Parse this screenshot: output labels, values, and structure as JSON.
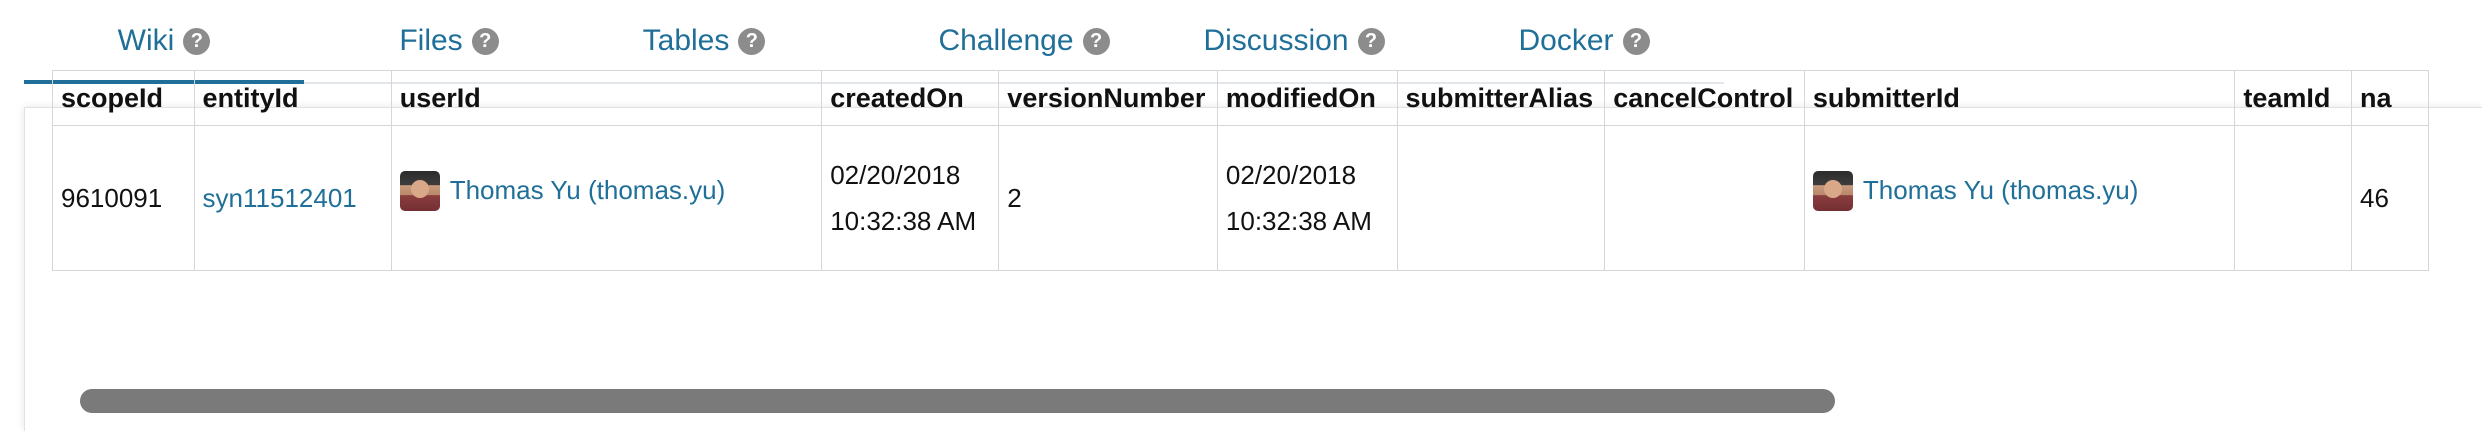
{
  "tabs": [
    {
      "label": "Wiki",
      "active": true
    },
    {
      "label": "Files",
      "active": false
    },
    {
      "label": "Tables",
      "active": false
    },
    {
      "label": "Challenge",
      "active": false
    },
    {
      "label": "Discussion",
      "active": false
    },
    {
      "label": "Docker",
      "active": false
    }
  ],
  "help_glyph": "?",
  "table": {
    "headers": [
      "scopeId",
      "entityId",
      "userId",
      "createdOn",
      "versionNumber",
      "modifiedOn",
      "submitterAlias",
      "cancelControl",
      "submitterId",
      "teamId",
      "na"
    ],
    "row": {
      "scopeId": "9610091",
      "entityId": "syn11512401",
      "userId": "Thomas Yu (thomas.yu)",
      "createdOn": "02/20/2018 10:32:38 AM",
      "versionNumber": "2",
      "modifiedOn": "02/20/2018 10:32:38 AM",
      "submitterAlias": "",
      "cancelControl": "",
      "submitterId": "Thomas Yu (thomas.yu)",
      "teamId": "",
      "na": "46"
    }
  },
  "colors": {
    "link": "#1f6f98",
    "tab_underline": "#1f6f98",
    "help_icon": "#8c8c8c",
    "scrollbar": "#7a7a7a"
  }
}
